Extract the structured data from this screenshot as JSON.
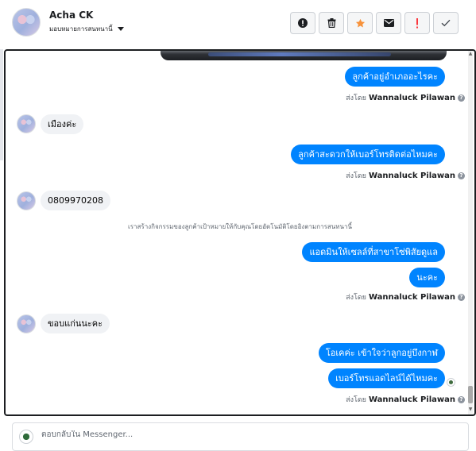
{
  "header": {
    "name": "Acha CK",
    "assign_label": "มอบหมายการสนทนานี้"
  },
  "actions": [
    {
      "name": "mark-spam-button",
      "icon": "exclamation-circle-icon"
    },
    {
      "name": "delete-button",
      "icon": "trash-icon"
    },
    {
      "name": "star-button",
      "icon": "star-icon",
      "color": "#f7923b"
    },
    {
      "name": "mark-unread-button",
      "icon": "envelope-icon"
    },
    {
      "name": "follow-up-button",
      "icon": "exclamation-icon",
      "color": "#fa383e"
    },
    {
      "name": "mark-done-button",
      "icon": "check-icon"
    }
  ],
  "messages": {
    "m1": "ลูกค้าอยู่อำเภออะไรคะ",
    "m2": "เมืองค่ะ",
    "m3": "ลูกค้าสะดวกให้เบอร์โทรติดต่อไหมคะ",
    "m4": "0809970208",
    "m5": "แอดมินให้เซลล์ที่สาขาโซ่พิสัยดูแล",
    "m6": "นะคะ",
    "m7": "ขอบแก่นนะคะ",
    "m8": "โอเคค่ะ  เข้าใจว่าลูกอยู่บึงกาฬ",
    "m9": "เบอร์โทรแอดไลน์ได้ไหมคะ"
  },
  "sent_by": {
    "prefix": "ส่งโดย",
    "sender": "Wannaluck Pilawan"
  },
  "system_note": "เราสร้างกิจกรรมของลูกค้าเป้าหมายให้กับคุณโดยอัตโนมัติโดยอิงตามการสนทนานี้",
  "reply": {
    "placeholder": "ตอบกลับใน Messenger..."
  },
  "colors": {
    "outgoing_bubble": "#0084ff",
    "incoming_bubble": "#f0f2f5"
  }
}
